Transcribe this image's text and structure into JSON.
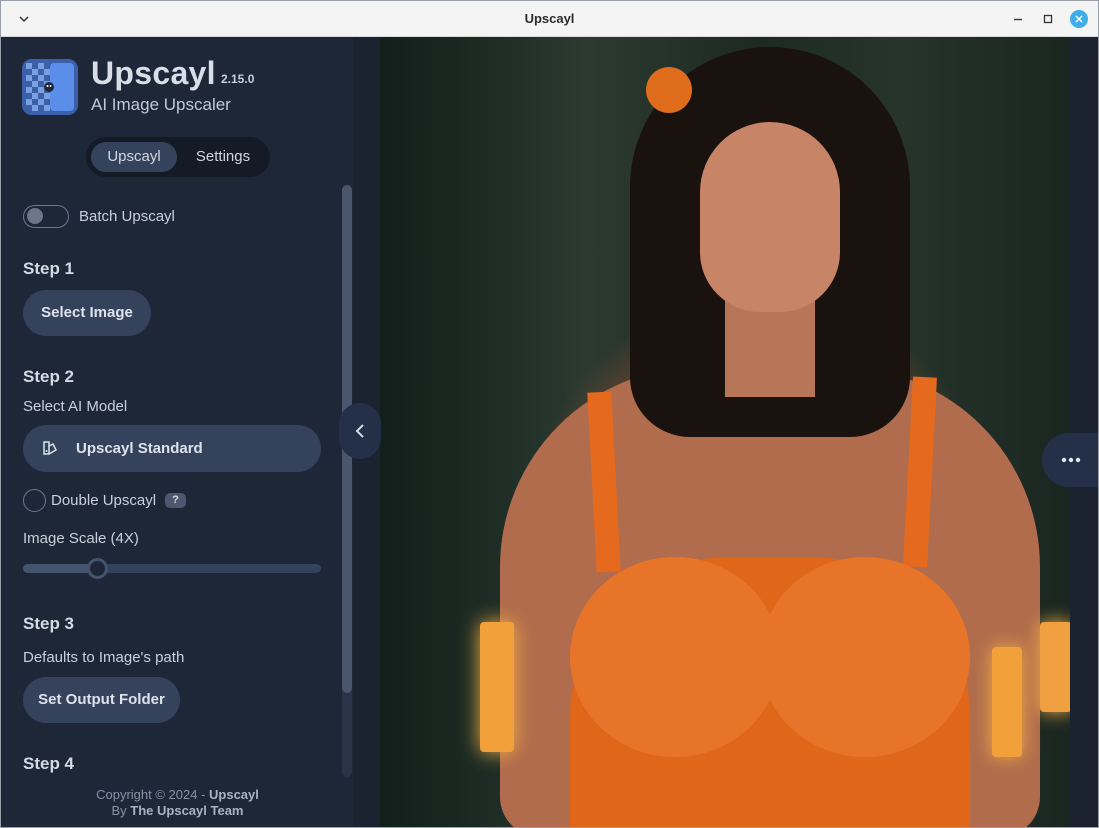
{
  "window": {
    "title": "Upscayl"
  },
  "app": {
    "name": "Upscayl",
    "version": "2.15.0",
    "tagline": "AI Image Upscaler"
  },
  "tabs": {
    "upscayl": "Upscayl",
    "settings": "Settings",
    "active": "Upscayl"
  },
  "batch": {
    "label": "Batch Upscayl",
    "enabled": false
  },
  "step1": {
    "heading": "Step 1",
    "button": "Select Image"
  },
  "step2": {
    "heading": "Step 2",
    "model_label": "Select AI Model",
    "model_value": "Upscayl Standard",
    "double_label": "Double Upscayl",
    "double_help": "?",
    "double_checked": false,
    "scale_label": "Image Scale (4X)",
    "scale_fraction": 0.23
  },
  "step3": {
    "heading": "Step 3",
    "hint": "Defaults to Image's path",
    "button": "Set Output Folder"
  },
  "step4": {
    "heading": "Step 4"
  },
  "footer": {
    "copyright_prefix": "Copyright © 2024 - ",
    "copyright_name": "Upscayl",
    "by_prefix": "By ",
    "by_name": "The Upscayl Team"
  },
  "colors": {
    "sidebar_bg": "#1d2738",
    "button_bg": "#34435b",
    "accent_close": "#3daee9"
  }
}
